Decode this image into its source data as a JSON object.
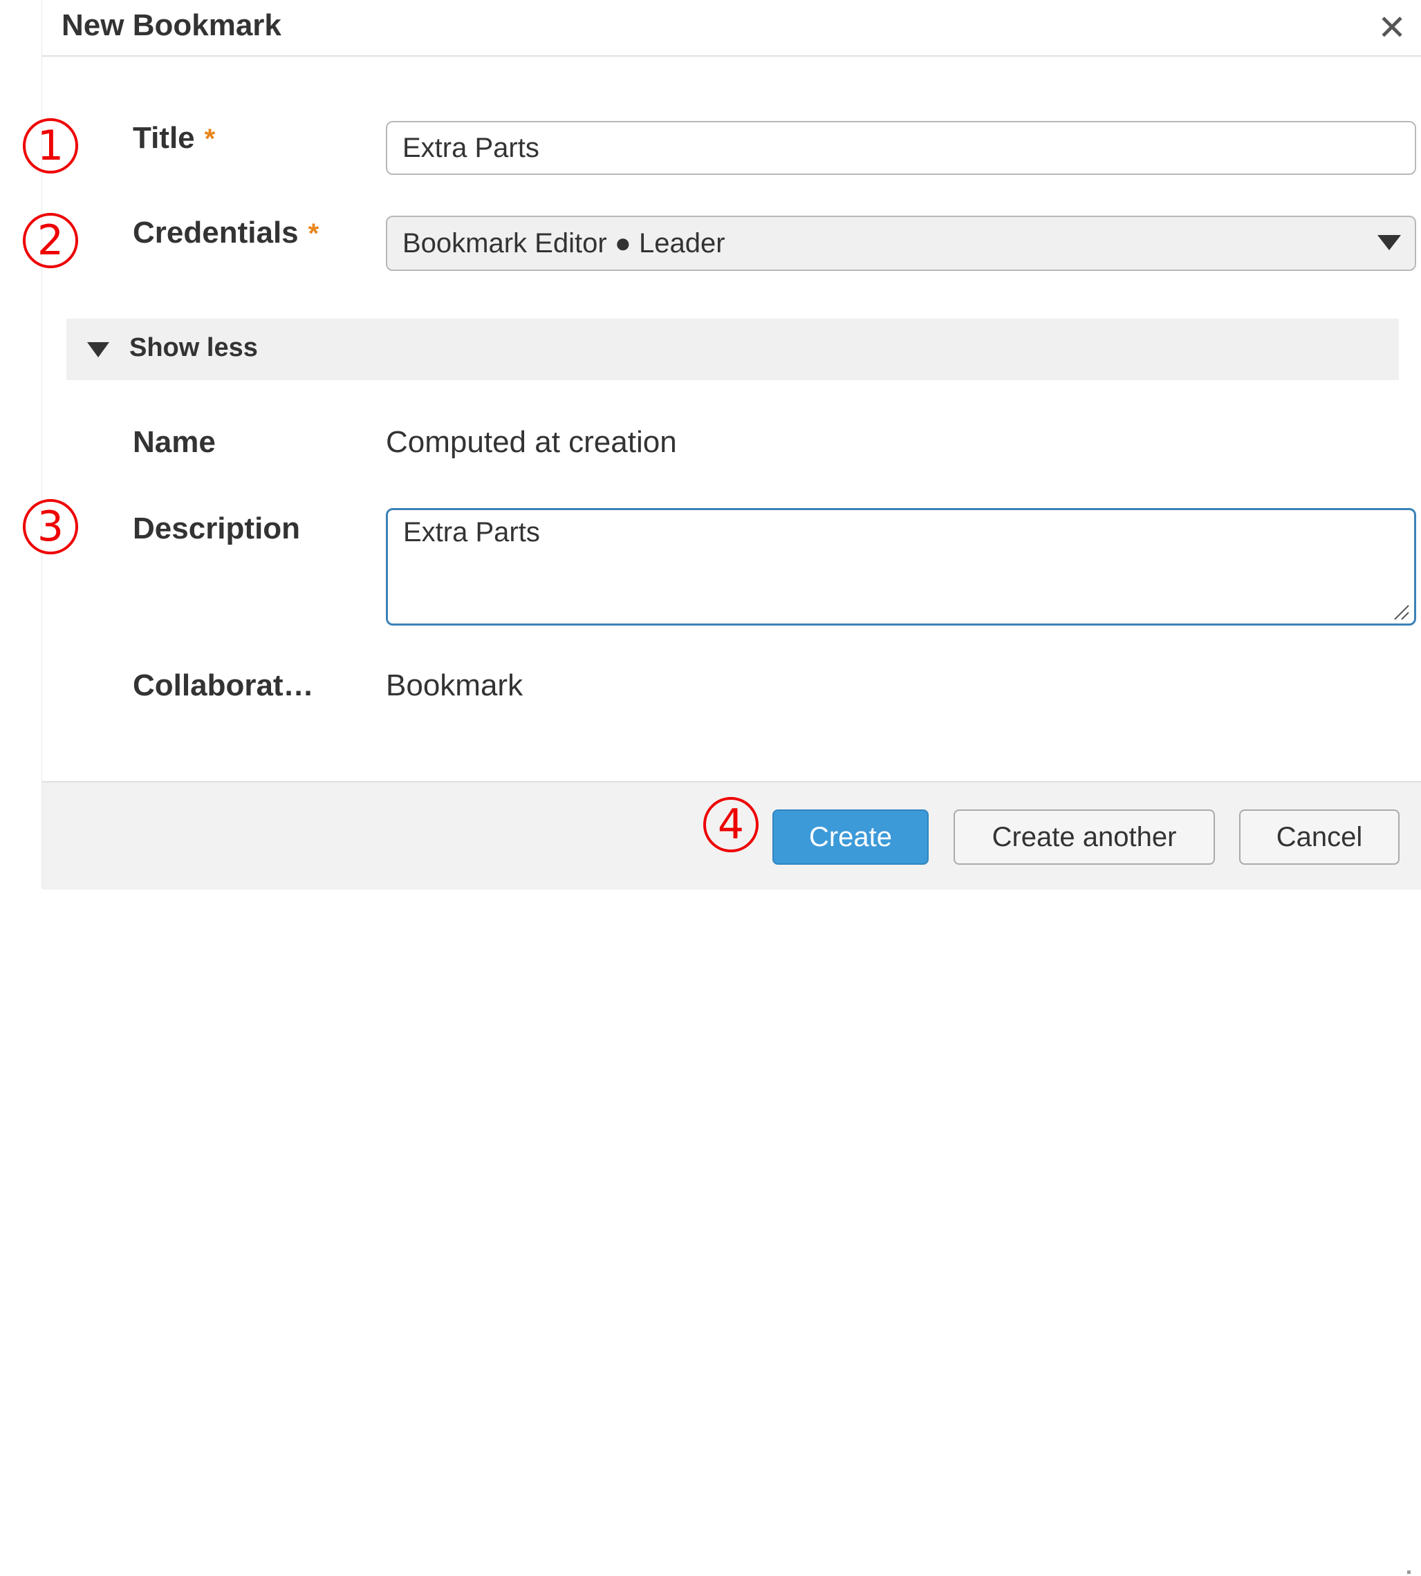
{
  "dialog": {
    "title": "New Bookmark",
    "close_icon": "close-icon"
  },
  "form": {
    "title": {
      "label": "Title",
      "required_mark": "*",
      "value": "Extra Parts"
    },
    "credentials": {
      "label": "Credentials",
      "required_mark": "*",
      "selected": "Bookmark Editor ● Leader"
    },
    "toggle": {
      "label": "Show less",
      "expanded": true
    },
    "name": {
      "label": "Name",
      "value": "Computed at creation"
    },
    "description": {
      "label": "Description",
      "value": "Extra Parts"
    },
    "collaboration": {
      "label": "Collaborat…",
      "value": "Bookmark"
    }
  },
  "footer": {
    "create_label": "Create",
    "create_another_label": "Create another",
    "cancel_label": "Cancel"
  },
  "annotations": {
    "marker_1": "①",
    "marker_2": "②",
    "marker_3": "③",
    "marker_4": "④",
    "color": "#ee0000"
  },
  "colors": {
    "primary_button": "#3d9ad8",
    "required_star": "#e8851c",
    "focus_border": "#3b82b8",
    "footer_background": "#f2f2f2"
  }
}
